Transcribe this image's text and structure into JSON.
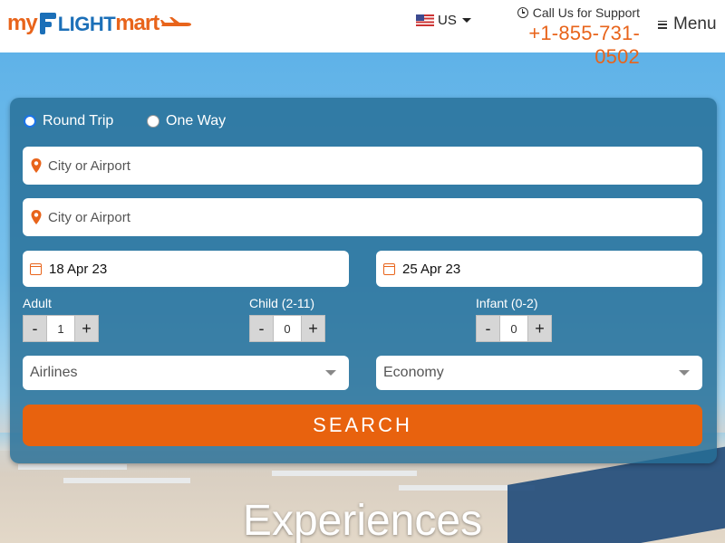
{
  "header": {
    "logo": {
      "my": "my",
      "flight": "LIGHT",
      "mart": "mart"
    },
    "country": {
      "label": "US"
    },
    "support": {
      "label": "Call Us for Support",
      "phone": "+1-855-731-0502"
    },
    "menu": {
      "label": "Menu"
    }
  },
  "search_form": {
    "trip_types": [
      {
        "label": "Round Trip",
        "selected": true
      },
      {
        "label": "One Way",
        "selected": false
      }
    ],
    "from": {
      "placeholder": "City or Airport",
      "value": ""
    },
    "to": {
      "placeholder": "City or Airport",
      "value": ""
    },
    "depart_date": "18 Apr 23",
    "return_date": "25 Apr 23",
    "passengers": {
      "adult": {
        "label": "Adult",
        "value": "1"
      },
      "child": {
        "label": "Child (2-11)",
        "value": "0"
      },
      "infant": {
        "label": "Infant (0-2)",
        "value": "0"
      }
    },
    "airlines": {
      "selected": "Airlines"
    },
    "cabin": {
      "selected": "Economy"
    },
    "search_label": "SEARCH"
  },
  "hero": {
    "title": "Experiences"
  },
  "colors": {
    "brand_orange": "#e8641b",
    "brand_blue": "#1b6fb8",
    "search_button": "#e8620e"
  },
  "icons": [
    "us-flag-icon",
    "clock-icon",
    "hamburger-icon",
    "map-pin-icon",
    "calendar-icon",
    "chevron-down-icon"
  ]
}
